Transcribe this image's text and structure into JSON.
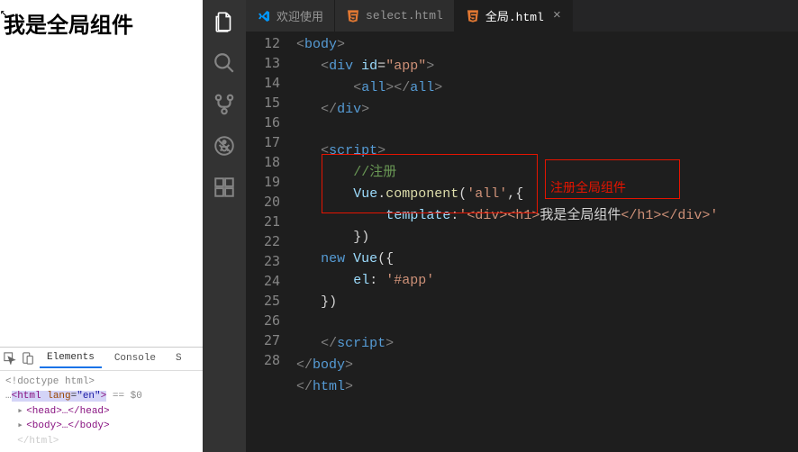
{
  "browser": {
    "heading": "我是全局组件"
  },
  "devtools": {
    "tabs": [
      "Elements",
      "Console",
      "S"
    ],
    "dom": {
      "doctype": "<!doctype html>",
      "html_open": "<html ",
      "lang_attr": "lang",
      "lang_val": "\"en\"",
      "sel": " == $0",
      "head": "<head>…</head>",
      "body": "<body>…</body>",
      "html_close": "</html>"
    }
  },
  "tabs": {
    "welcome": "欢迎使用",
    "select": "select.html",
    "global": "全局.html"
  },
  "annotation": "注册全局组件",
  "code": {
    "line_numbers": [
      "",
      "12",
      "13",
      "14",
      "15",
      "16",
      "17",
      "18",
      "19",
      "20",
      "21",
      "22",
      "23",
      "24",
      "25",
      "26",
      "27",
      "28"
    ],
    "l13_attr": "id",
    "l13_val": "\"app\"",
    "l14_tag": "all",
    "l18_cmt": "//注册",
    "l19_obj": "Vue",
    "l19_fn": "component",
    "l19_arg": "'all'",
    "l20_prop": "template",
    "l20_val1": "'<div><h1>",
    "l20_txt": "我是全局组件",
    "l20_val2": "</h1></div>'",
    "l22_kw": "new",
    "l22_cls": "Vue",
    "l23_prop": "el",
    "l23_val": "'#app'"
  }
}
